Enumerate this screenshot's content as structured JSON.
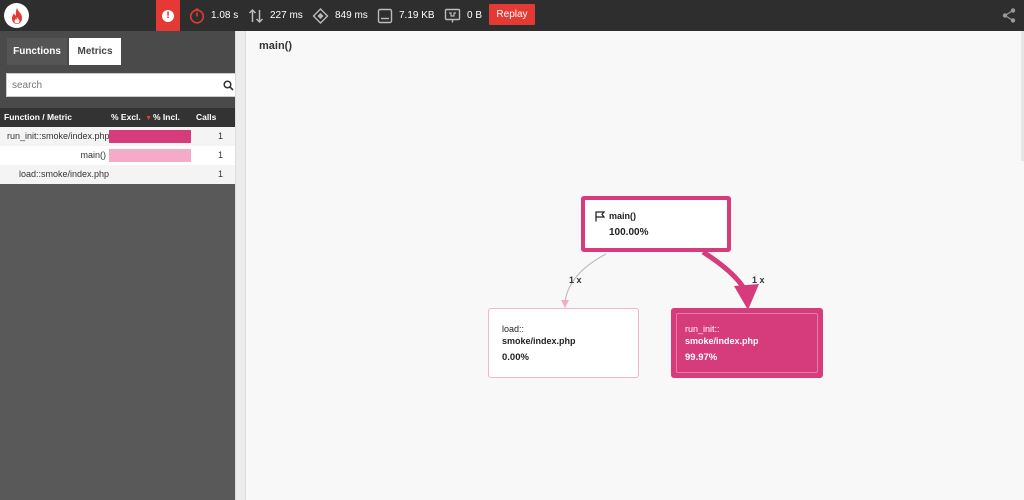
{
  "topbar": {
    "metrics": [
      {
        "icon": "stopwatch-icon",
        "value": "1.08 s"
      },
      {
        "icon": "up-down-arrows-icon",
        "value": "227 ms"
      },
      {
        "icon": "cpu-chip-icon",
        "value": "849 ms"
      },
      {
        "icon": "memory-icon",
        "value": "7.19 KB"
      },
      {
        "icon": "network-icon",
        "value": "0 B"
      }
    ],
    "replay_label": "Replay",
    "alert_glyph": "!"
  },
  "sidebar": {
    "tabs": [
      {
        "label": "Functions",
        "active": true
      },
      {
        "label": "Metrics",
        "active": false
      }
    ],
    "search": {
      "placeholder": "search",
      "value": ""
    },
    "table": {
      "headers": [
        "Function / Metric",
        "% Excl.",
        "% Incl.",
        "Calls"
      ],
      "sort_indicator": "▼",
      "rows": [
        {
          "name": "run_init::smoke/index.php",
          "calls": "1",
          "bar_color": "#d63b7c"
        },
        {
          "name": "main()",
          "calls": "1",
          "bar_color": "#f4aac9"
        },
        {
          "name": "load::smoke/index.php",
          "calls": "1",
          "bar_color": ""
        }
      ]
    }
  },
  "graph": {
    "title": "main()",
    "nodes": {
      "main": {
        "label": "main()",
        "percent": "100.00%"
      },
      "load": {
        "label_top": "load::",
        "label_bottom": "smoke/index.php",
        "percent": "0.00%"
      },
      "run": {
        "label_top": "run_init::",
        "label_bottom": "smoke/index.php",
        "percent": "99.97%"
      }
    },
    "edges": [
      {
        "from": "main",
        "to": "load",
        "label": "1 x"
      },
      {
        "from": "main",
        "to": "run",
        "label": "1 x"
      }
    ]
  },
  "colors": {
    "accent": "#d63b7c",
    "accent_light": "#f4aac9",
    "alert": "#e53935",
    "topbar": "#2e2e2e"
  }
}
